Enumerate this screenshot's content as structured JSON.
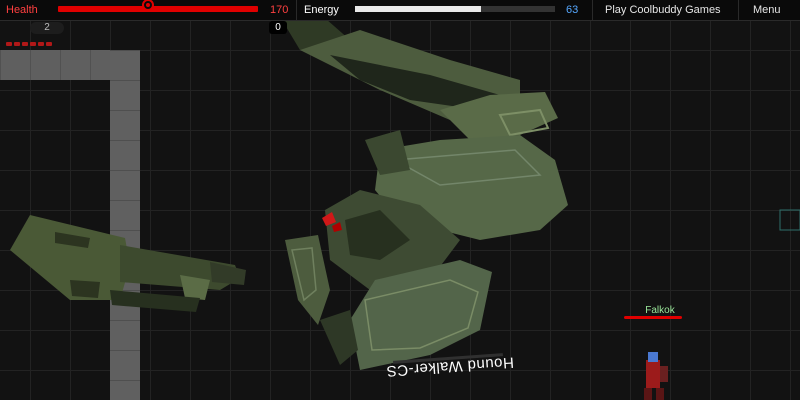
{
  "hud": {
    "health_label": "Health",
    "health_value": "170",
    "health_fraction": 1.0,
    "health_color": "#e00000",
    "energy_label": "Energy",
    "energy_value": "63",
    "energy_fraction": 0.63,
    "energy_value_color": "#56a8ff",
    "play_label": "Play Coolbuddy Games",
    "menu_label": "Menu"
  },
  "status": {
    "sub_value": "2",
    "score_value": "0",
    "ammo_count": 6
  },
  "enemies": {
    "falkok_name": "Falkok",
    "boss_name": "Hound Walker-CS"
  },
  "icons": {
    "health": "heart-icon"
  }
}
